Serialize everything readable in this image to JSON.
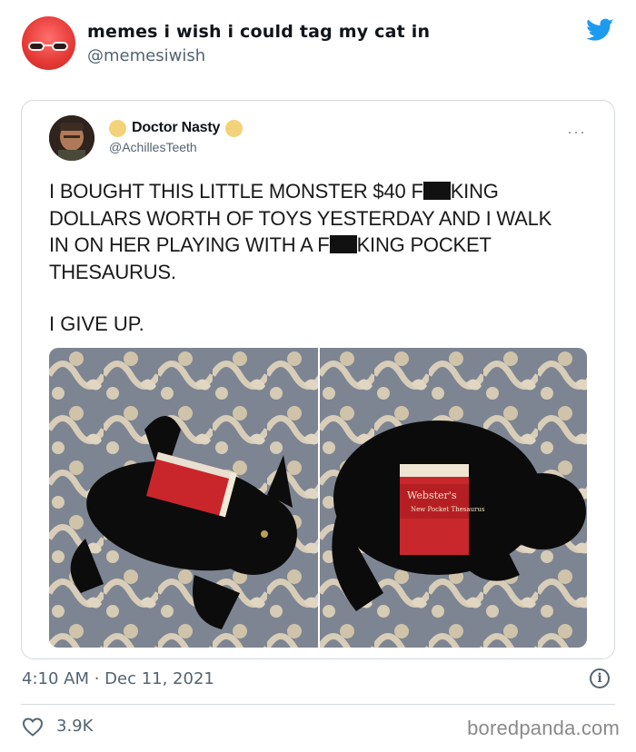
{
  "tweet": {
    "display_name": "memes i wish i could tag my cat in",
    "handle": "@memesiwish",
    "timestamp": "4:10 AM · Dec 11, 2021",
    "likes": "3.9K",
    "icons": {
      "brand": "twitter-bird-icon",
      "like": "heart-icon",
      "info": "info-icon"
    },
    "colors": {
      "brand": "#1d9bf0",
      "secondary_text": "#536471"
    }
  },
  "quoted_tweet": {
    "display_name": "Doctor Nasty",
    "handle": "@AchillesTeeth",
    "more": "···",
    "text_line1": "I BOUGHT THIS LITTLE MONSTER $40 F",
    "text_line1b": "KING",
    "text_line2": "DOLLARS WORTH OF TOYS YESTERDAY AND I WALK",
    "text_line3": "IN ON HER PLAYING WITH A F",
    "text_line3b": "KING POCKET",
    "text_line4": "THESAURUS.",
    "text_line5": "I GIVE UP."
  },
  "photos": {
    "book_label": "Webster's",
    "book_sub": "New Pocket Thesaurus"
  },
  "watermark": "boredpanda.com"
}
